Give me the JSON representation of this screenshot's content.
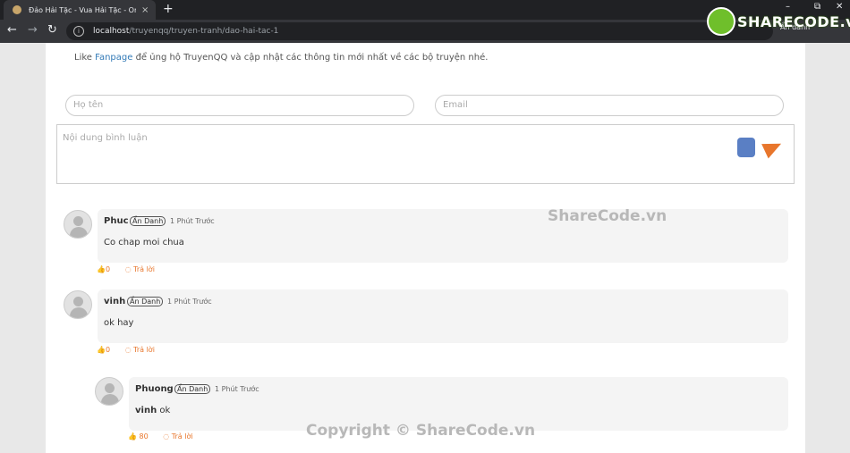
{
  "browser": {
    "tab_title": "Đảo Hải Tặc - Vua Hải Tặc - One",
    "tab_close": "×",
    "new_tab": "+",
    "min": "–",
    "restore": "⧉",
    "close": "✕",
    "url_host": "localhost",
    "url_path": "/truyenqq/truyen-tranh/dao-hai-tac-1",
    "incognito": "Ẩn danh"
  },
  "logo": {
    "text": "SHARECODE.vn"
  },
  "notice": {
    "prefix": "Like ",
    "link": "Fanpage",
    "suffix": " để ủng hộ TruyenQQ và cập nhật các thông tin mới nhất về các bộ truyện nhé."
  },
  "form": {
    "name_placeholder": "Họ tên",
    "email_placeholder": "Email",
    "content_placeholder": "Nội dung bình luận"
  },
  "comments": [
    {
      "name": "Phuc",
      "badge": "Ẩn Danh",
      "time": "1 Phút Trước",
      "text": "Co chap moi chua",
      "likes": "0",
      "reply": "Trả lời"
    },
    {
      "name": "vinh",
      "badge": "Ẩn Danh",
      "time": "1 Phút Trước",
      "text": "ok hay",
      "likes": "0",
      "reply": "Trả lời"
    },
    {
      "name": "Phuong",
      "badge": "Ẩn Danh",
      "time": "1 Phút Trước",
      "mention": "vinh",
      "text": " ok",
      "likes": "80",
      "reply": "Trả lời"
    }
  ],
  "watermarks": {
    "mid": "ShareCode.vn",
    "bottom": "Copyright © ShareCode.vn"
  }
}
